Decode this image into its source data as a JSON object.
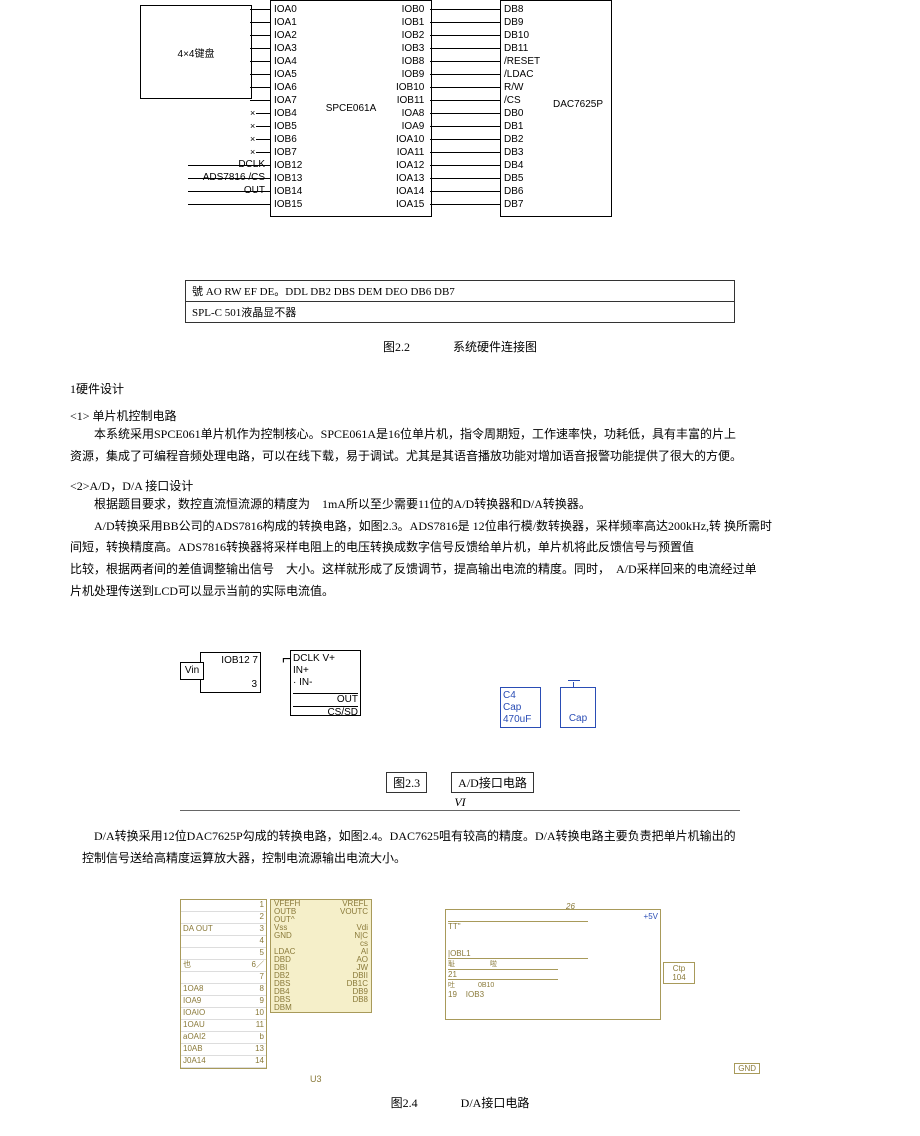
{
  "fig22": {
    "keyboard_label": "4×4键盘",
    "mcu_label": "SPCE061A",
    "dac_label": "DAC7625P",
    "ads_labels": {
      "dclk": "DCLK",
      "cs": "ADS7816  /CS",
      "out": "OUT"
    },
    "left_col": [
      "IOA0",
      "IOA1",
      "IOA2",
      "IOA3",
      "IOA4",
      "IOA5",
      "IOA6",
      "IOA7",
      "IOB4",
      "IOB5",
      "IOB6",
      "IOB7",
      "IOB12",
      "IOB13",
      "IOB14",
      "IOB15"
    ],
    "right_col": [
      "IOB0",
      "IOB1",
      "IOB2",
      "IOB3",
      "IOB8",
      "IOB9",
      "IOB10",
      "IOB11",
      "IOA8",
      "IOA9",
      "IOA10",
      "IOA11",
      "IOA12",
      "IOA13",
      "IOA14",
      "IOA15"
    ],
    "dac_col": [
      "DB8",
      "DB9",
      "DB10",
      "DB11",
      "/RESET",
      "/LDAC",
      "R/W",
      "/CS",
      "DB0",
      "DB1",
      "DB2",
      "DB3",
      "DB4",
      "DB5",
      "DB6",
      "DB7"
    ]
  },
  "lcd_bar": {
    "pins": "號  AO RW EF DE。DDL DB2 DBS DEM DEO DB6 DB7",
    "name": "SPL-C 501液晶显不器"
  },
  "cap22": {
    "num": "图2.2",
    "title": "系统硬件连接图"
  },
  "section1": {
    "head": "1硬件设计",
    "s1": "<1> 单片机控制电路",
    "p1": "本系统采用SPCE061单片机作为控制核心。SPCE061A是16位单片机，指令周期短，工作速率快，功耗低，具有丰富的片上",
    "p1b": "资源，集成了可编程音频处理电路，可以在线下载，易于调试。尤其是其语音播放功能对增加语音报警功能提供了很大的方便。",
    "s2": "<2>A/D，D/A 接口设计",
    "p2": "根据题目要求，数控直流恒流源的精度为　1mA所以至少需要11位的A/D转换器和D/A转换器。",
    "p3": "A/D转换采用BB公司的ADS7816构成的转换电路，如图2.3。ADS7816是 12位串行模/数转换器，采样频率高达200kHz,转 换所需时",
    "p3b": "间短，转换精度高。ADS7816转换器将采样电阻上的电压转换成数字信号反馈给单片机，单片机将此反馈信号与预置值",
    "p4a": "比较，根据两者间的差值调整输出信号　大小。这样就形成了反馈调节，提高输出电流的精度。同时，　A/D采样回来的电流经过单",
    "p4b": "片机处理传送到LCD可以显示当前的实际电流值。"
  },
  "fig23": {
    "vin": "Vin",
    "iob12": "IOB12 7",
    "three": "3",
    "dclk": "DCLK V+",
    "inp": "IN+",
    "inm": "· IN-",
    "out": "OUT",
    "cs": "CS/SD",
    "c4": {
      "name": "C4",
      "type": "Cap",
      "val": "470uF"
    },
    "cap2": "Cap"
  },
  "cap23": {
    "num": "图2.3",
    "title": "A/D接口电路",
    "vi": "VI"
  },
  "p5a": "D/A转换采用12位DAC7625P勾成的转换电路，如图2.4。DAC7625咀有较高的精度。D/A转换电路主要负责把单片机输出的",
  "p5b": "控制信号送给高精度运算放大器，控制电流源输出电流大小。",
  "fig24": {
    "chip": {
      "rows": [
        [
          "VFEFH",
          "VREFL"
        ],
        [
          "OUTB",
          "VOUTC"
        ],
        [
          "OUT^",
          ""
        ],
        [
          "Vss",
          "Vdi"
        ],
        [
          "GND",
          "N|C"
        ],
        [
          "",
          "cs"
        ],
        [
          "LDAC",
          "Al"
        ],
        [
          "DBD",
          "AO"
        ],
        [
          "DBI",
          "JW"
        ],
        [
          "DB2",
          "DBII"
        ],
        [
          "DBS",
          "DB1C"
        ],
        [
          "DB4",
          "DB9"
        ],
        [
          "DBS",
          "DB8"
        ],
        [
          "DBM",
          ""
        ]
      ],
      "u3": "U3"
    },
    "left_pins": [
      [
        "",
        "1"
      ],
      [
        "",
        "2"
      ],
      [
        "DA OUT",
        "3"
      ],
      [
        "",
        "4"
      ],
      [
        "",
        "5"
      ],
      [
        "也",
        "6／"
      ],
      [
        "",
        "7"
      ],
      [
        "1OA8",
        "8"
      ],
      [
        "IOA9",
        "9"
      ],
      [
        "IOAIO",
        "10"
      ],
      [
        "1OAU",
        "11"
      ],
      [
        "aOAI2",
        "b"
      ],
      [
        "10AB",
        "13"
      ],
      [
        "J0A14",
        "14"
      ]
    ],
    "right_box": {
      "v5": "+5V",
      "net26": "26",
      "tt": "TT\"",
      "iobl1": "|OBL1",
      "res": "耻　　　　　啦",
      "n21": "21",
      "hh": "吐　　　 0B10",
      "n19": "19",
      "iob3": "IOB3",
      "ctp": "Ctp",
      "c104": "104"
    },
    "gnd": "GND"
  },
  "cap24": {
    "num": "图2.4",
    "title": "D/A接口电路"
  }
}
